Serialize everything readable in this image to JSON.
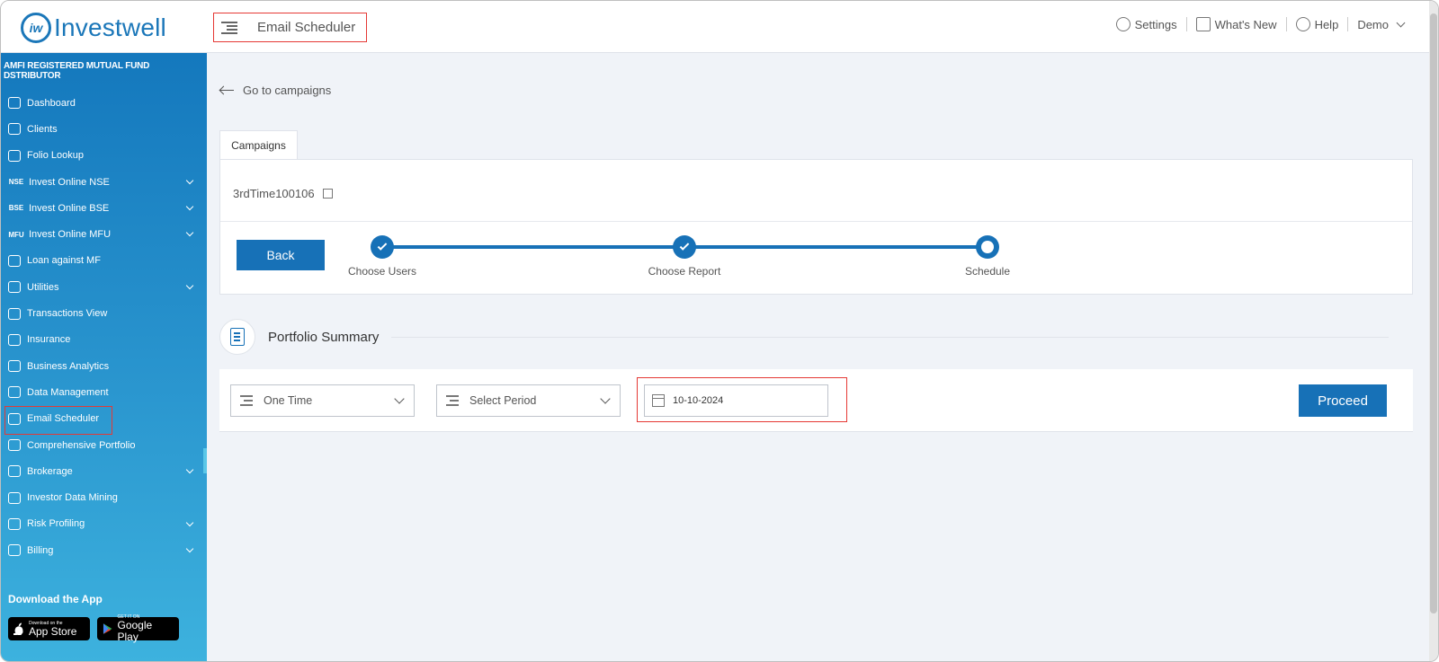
{
  "header": {
    "logo_mark": "iw",
    "logo_text": "Investwell",
    "page_title": "Email Scheduler",
    "settings": "Settings",
    "whats_new": "What's New",
    "help": "Help",
    "user": "Demo"
  },
  "sidebar": {
    "heading": "AMFI REGISTERED MUTUAL FUND DSTRIBUTOR",
    "items": [
      {
        "label": "Dashboard",
        "icon": "home-icon",
        "badge": "",
        "arrow": false
      },
      {
        "label": "Clients",
        "icon": "users-icon",
        "badge": "",
        "arrow": false
      },
      {
        "label": "Folio Lookup",
        "icon": "rupee-doc-icon",
        "badge": "",
        "arrow": false
      },
      {
        "label": "Invest Online NSE",
        "icon": "",
        "badge": "NSE",
        "arrow": true
      },
      {
        "label": "Invest Online BSE",
        "icon": "",
        "badge": "BSE",
        "arrow": true
      },
      {
        "label": "Invest Online MFU",
        "icon": "",
        "badge": "MFU",
        "arrow": true
      },
      {
        "label": "Loan against MF",
        "icon": "money-bag-icon",
        "badge": "",
        "arrow": false
      },
      {
        "label": "Utilities",
        "icon": "search-gear-icon",
        "badge": "",
        "arrow": true
      },
      {
        "label": "Transactions View",
        "icon": "swap-icon",
        "badge": "",
        "arrow": false
      },
      {
        "label": "Insurance",
        "icon": "document-icon",
        "badge": "",
        "arrow": false
      },
      {
        "label": "Business Analytics",
        "icon": "chart-icon",
        "badge": "",
        "arrow": false
      },
      {
        "label": "Data Management",
        "icon": "database-icon",
        "badge": "",
        "arrow": false
      },
      {
        "label": "Email Scheduler",
        "icon": "mail-clock-icon",
        "badge": "",
        "arrow": false
      },
      {
        "label": "Comprehensive Portfolio",
        "icon": "briefcase-icon",
        "badge": "",
        "arrow": false
      },
      {
        "label": "Brokerage",
        "icon": "percent-icon",
        "badge": "",
        "arrow": true
      },
      {
        "label": "Investor Data Mining",
        "icon": "rupee-icon",
        "badge": "",
        "arrow": false
      },
      {
        "label": "Risk Profiling",
        "icon": "gauge-icon",
        "badge": "",
        "arrow": true
      },
      {
        "label": "Billing",
        "icon": "bill-icon",
        "badge": "",
        "arrow": true
      }
    ],
    "download_label": "Download the App",
    "app_store_small": "Download on the",
    "app_store_big": "App Store",
    "google_play_small": "GET IT ON",
    "google_play_big": "Google Play"
  },
  "main": {
    "go_to_campaigns": "Go to campaigns",
    "tab_label": "Campaigns",
    "campaign_name": "3rdTime100106",
    "back_button": "Back",
    "steps": [
      {
        "label": "Choose Users",
        "state": "done"
      },
      {
        "label": "Choose Report",
        "state": "done"
      },
      {
        "label": "Schedule",
        "state": "current"
      }
    ],
    "section_title": "Portfolio Summary",
    "frequency_value": "One Time",
    "period_placeholder": "Select Period",
    "date_value": "10-10-2024",
    "proceed_button": "Proceed"
  },
  "colors": {
    "brand": "#1771b7",
    "highlight": "#e53935"
  }
}
